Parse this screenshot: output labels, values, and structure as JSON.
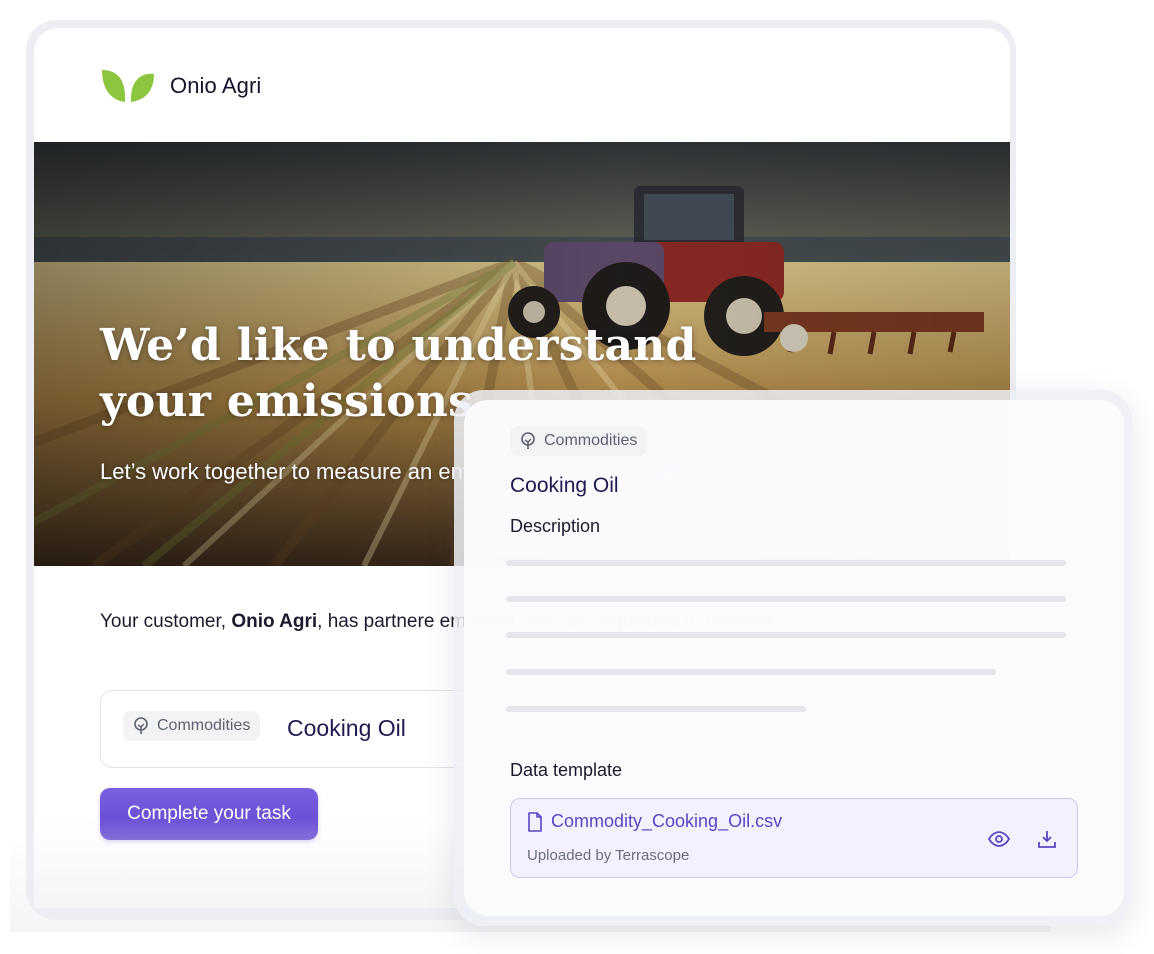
{
  "brand": {
    "name": "Onio Agri",
    "accent": "#8cc63f"
  },
  "hero": {
    "title": "We’d like to understand your emissions",
    "subtitle": "Let’s work together to measure an environmental impact 🌎"
  },
  "email_body": {
    "prefix": "Your customer, ",
    "customer": "Onio Agri",
    "suffix": ", has partnere emission. You are requested to complet"
  },
  "task_card": {
    "chip_label": "Commodities",
    "chip_icon": "tree-icon",
    "name": "Cooking Oil"
  },
  "cta": {
    "label": "Complete your task",
    "color": "#6a4fd6"
  },
  "panel": {
    "chip_label": "Commodities",
    "chip_icon": "tree-icon",
    "title": "Cooking Oil",
    "description_label": "Description",
    "data_template_label": "Data template",
    "file": {
      "name": "Commodity_Cooking_Oil.csv",
      "icon": "file-icon",
      "uploaded_by": "Uploaded by Terrascope",
      "actions": [
        "eye-icon",
        "download-icon"
      ]
    }
  }
}
